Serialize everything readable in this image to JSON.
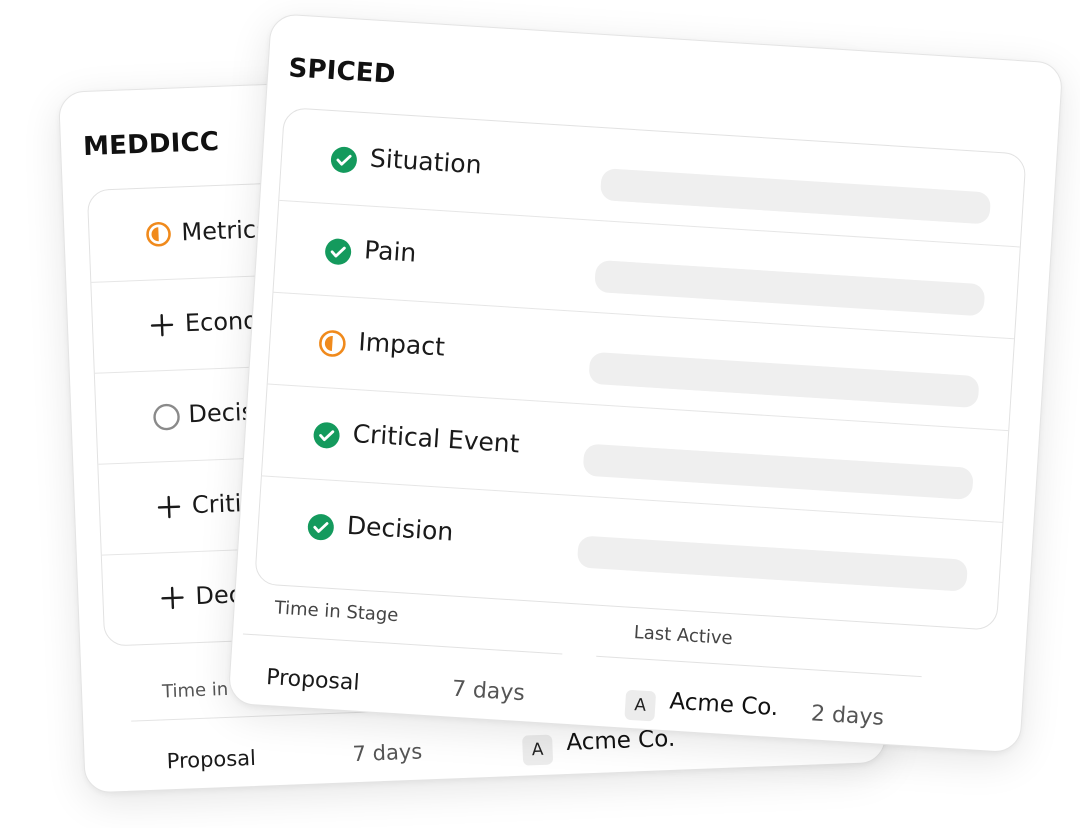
{
  "meddicc_card": {
    "title": "MEDDICC",
    "rows": [
      {
        "label": "Metrics",
        "status": "in-progress"
      },
      {
        "label": "Econom",
        "status": "add"
      },
      {
        "label": "Decisio",
        "status": "empty"
      },
      {
        "label": "Critica",
        "status": "add"
      },
      {
        "label": "Decis",
        "status": "add"
      }
    ],
    "footer": {
      "time_in_stage_header": "Time in S",
      "stage": "Proposal",
      "stage_days": "7 days",
      "company_initial": "A",
      "company": "Acme Co."
    }
  },
  "spiced_card": {
    "title": "SPICED",
    "rows": [
      {
        "label": "Situation",
        "status": "complete"
      },
      {
        "label": "Pain",
        "status": "complete"
      },
      {
        "label": "Impact",
        "status": "in-progress"
      },
      {
        "label": "Critical Event",
        "status": "complete"
      },
      {
        "label": "Decision",
        "status": "complete"
      }
    ],
    "footer": {
      "time_in_stage_header": "Time in Stage",
      "last_active_header": "Last Active",
      "stage": "Proposal",
      "stage_days": "7 days",
      "company_initial": "A",
      "company": "Acme Co.",
      "last_active_days": "2 days"
    }
  },
  "colors": {
    "complete": "#149a5d",
    "in_progress": "#f08a1c",
    "empty": "#8a8a8a",
    "placeholder": "#efefef"
  }
}
